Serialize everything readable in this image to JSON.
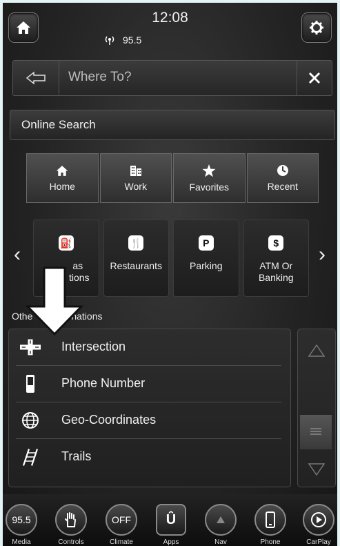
{
  "status": {
    "time": "12:08",
    "radio": "95.5"
  },
  "search": {
    "placeholder": "Where To?"
  },
  "online_search": {
    "label": "Online Search"
  },
  "quick_destinations": [
    {
      "label": "Home",
      "icon": "home-icon"
    },
    {
      "label": "Work",
      "icon": "building-icon"
    },
    {
      "label": "Favorites",
      "icon": "star-icon"
    },
    {
      "label": "Recent",
      "icon": "clock-icon"
    }
  ],
  "categories": [
    {
      "label": "Gas\nStations",
      "visible_label": [
        "as",
        "tions"
      ],
      "icon": "gas-icon"
    },
    {
      "label": "Restaurants",
      "icon": "restaurant-icon"
    },
    {
      "label": "Parking",
      "icon": "parking-icon"
    },
    {
      "label": "ATM Or\nBanking",
      "icon": "atm-icon"
    }
  ],
  "other_destinations": {
    "header_left": "Othe",
    "header_right": "nations",
    "items": [
      {
        "label": "Intersection",
        "icon": "intersection-icon"
      },
      {
        "label": "Phone Number",
        "icon": "phone-icon"
      },
      {
        "label": "Geo-Coordinates",
        "icon": "globe-icon"
      },
      {
        "label": "Trails",
        "icon": "trails-icon"
      }
    ]
  },
  "dock": [
    {
      "label": "Media",
      "badge": "95.5"
    },
    {
      "label": "Controls"
    },
    {
      "label": "Climate",
      "badge": "OFF"
    },
    {
      "label": "Apps",
      "badge": "Û"
    },
    {
      "label": "Nav"
    },
    {
      "label": "Phone"
    },
    {
      "label": "CarPlay"
    }
  ],
  "colors": {
    "accent": "#f2f2f2",
    "background": "#242424"
  }
}
